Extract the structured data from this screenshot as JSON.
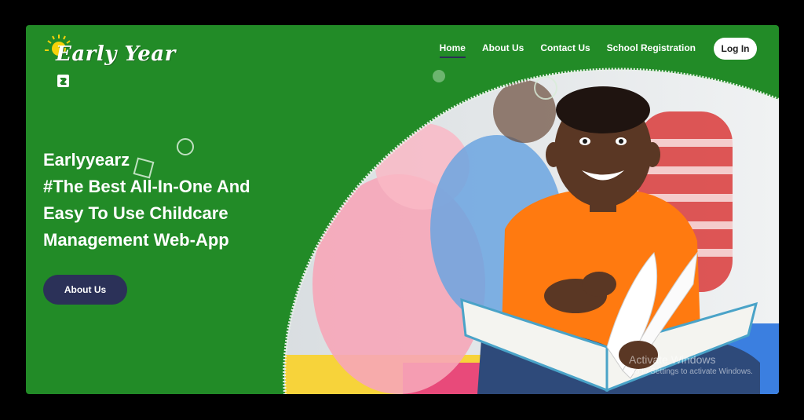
{
  "brand": {
    "logo_text": "Early Year",
    "logo_z": "z"
  },
  "nav": {
    "items": [
      {
        "label": "Home",
        "active": true
      },
      {
        "label": "About Us",
        "active": false
      },
      {
        "label": "Contact Us",
        "active": false
      },
      {
        "label": "School Registration",
        "active": false
      }
    ],
    "login_label": "Log In"
  },
  "hero": {
    "lines": [
      "Earlyyearz",
      "#The Best All-In-One And",
      "Easy To Use Childcare",
      "Management Web-App"
    ],
    "cta_label": "About Us"
  },
  "watermark": {
    "line1": "Activate Windows",
    "line2": "Go to Settings to activate Windows."
  },
  "colors": {
    "primary_green": "#228b27",
    "button_navy": "#2b3158",
    "shirt_orange": "#ff7a10",
    "white": "#ffffff"
  }
}
